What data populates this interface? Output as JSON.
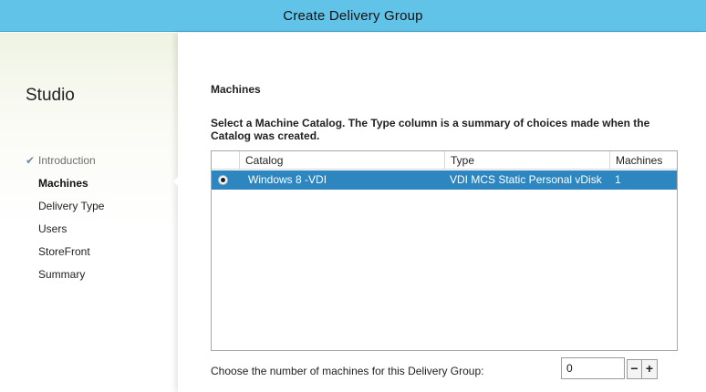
{
  "window": {
    "title": "Create Delivery Group"
  },
  "sidebar": {
    "heading": "Studio",
    "steps": [
      {
        "label": "Introduction",
        "state": "done"
      },
      {
        "label": "Machines",
        "state": "current"
      },
      {
        "label": "Delivery Type",
        "state": "pending"
      },
      {
        "label": "Users",
        "state": "pending"
      },
      {
        "label": "StoreFront",
        "state": "pending"
      },
      {
        "label": "Summary",
        "state": "pending"
      }
    ],
    "check_glyph": "✔"
  },
  "main": {
    "section_title": "Machines",
    "instruction": "Select a Machine Catalog. The Type column is a summary of choices made when the Catalog was created.",
    "table": {
      "columns": [
        "Catalog",
        "Type",
        "Machines"
      ],
      "rows": [
        {
          "selected": true,
          "catalog": "Windows 8 -VDI",
          "type": "VDI MCS Static Personal vDisk",
          "machines": "1"
        }
      ]
    },
    "machine_count": {
      "label": "Choose the number of machines for this Delivery Group:",
      "value": "0",
      "decrement": "−",
      "increment": "+"
    }
  },
  "colors": {
    "titlebar": "#62c3e8",
    "selected_row": "#2e86c1"
  }
}
